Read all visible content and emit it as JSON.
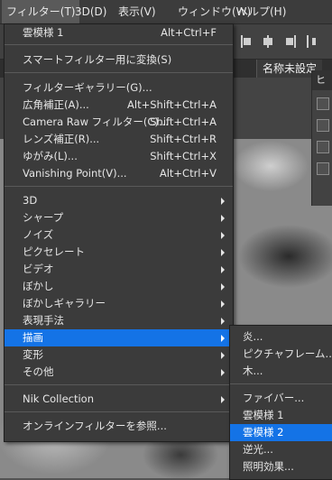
{
  "menubar": {
    "items": [
      {
        "label": "フィルター(T)",
        "active": true
      },
      {
        "label": "3D(D)"
      },
      {
        "label": "表示(V)"
      },
      {
        "label": "ウィンドウ(W)"
      },
      {
        "label": "ヘルプ(H)"
      }
    ]
  },
  "document_tab": {
    "title": "名称未設定"
  },
  "panel": {
    "header": "ヒス"
  },
  "filter_menu": {
    "last_filter": {
      "label": "雲模様 1",
      "shortcut": "Alt+Ctrl+F"
    },
    "convert_smart": {
      "label": "スマートフィルター用に変換(S)"
    },
    "group1": [
      {
        "label": "フィルターギャラリー(G)...",
        "shortcut": ""
      },
      {
        "label": "広角補正(A)...",
        "shortcut": "Alt+Shift+Ctrl+A"
      },
      {
        "label": "Camera Raw フィルター(C)...",
        "shortcut": "Shift+Ctrl+A"
      },
      {
        "label": "レンズ補正(R)...",
        "shortcut": "Shift+Ctrl+R"
      },
      {
        "label": "ゆがみ(L)...",
        "shortcut": "Shift+Ctrl+X"
      },
      {
        "label": "Vanishing Point(V)...",
        "shortcut": "Alt+Ctrl+V"
      }
    ],
    "submenus": [
      {
        "label": "3D"
      },
      {
        "label": "シャープ"
      },
      {
        "label": "ノイズ"
      },
      {
        "label": "ピクセレート"
      },
      {
        "label": "ビデオ"
      },
      {
        "label": "ぼかし"
      },
      {
        "label": "ぼかしギャラリー"
      },
      {
        "label": "表現手法"
      },
      {
        "label": "描画",
        "highlighted": true
      },
      {
        "label": "変形"
      },
      {
        "label": "その他"
      }
    ],
    "nik": {
      "label": "Nik Collection"
    },
    "browse_online": {
      "label": "オンラインフィルターを参照..."
    }
  },
  "render_submenu": {
    "group1": [
      {
        "label": "炎..."
      },
      {
        "label": "ピクチャフレーム..."
      },
      {
        "label": "木..."
      }
    ],
    "group2": [
      {
        "label": "ファイバー..."
      },
      {
        "label": "雲模様 1"
      },
      {
        "label": "雲模様 2",
        "highlighted": true
      },
      {
        "label": "逆光..."
      },
      {
        "label": "照明効果..."
      }
    ]
  },
  "colors": {
    "highlight": "#1473e6",
    "menu_bg": "#3b3b3b"
  }
}
